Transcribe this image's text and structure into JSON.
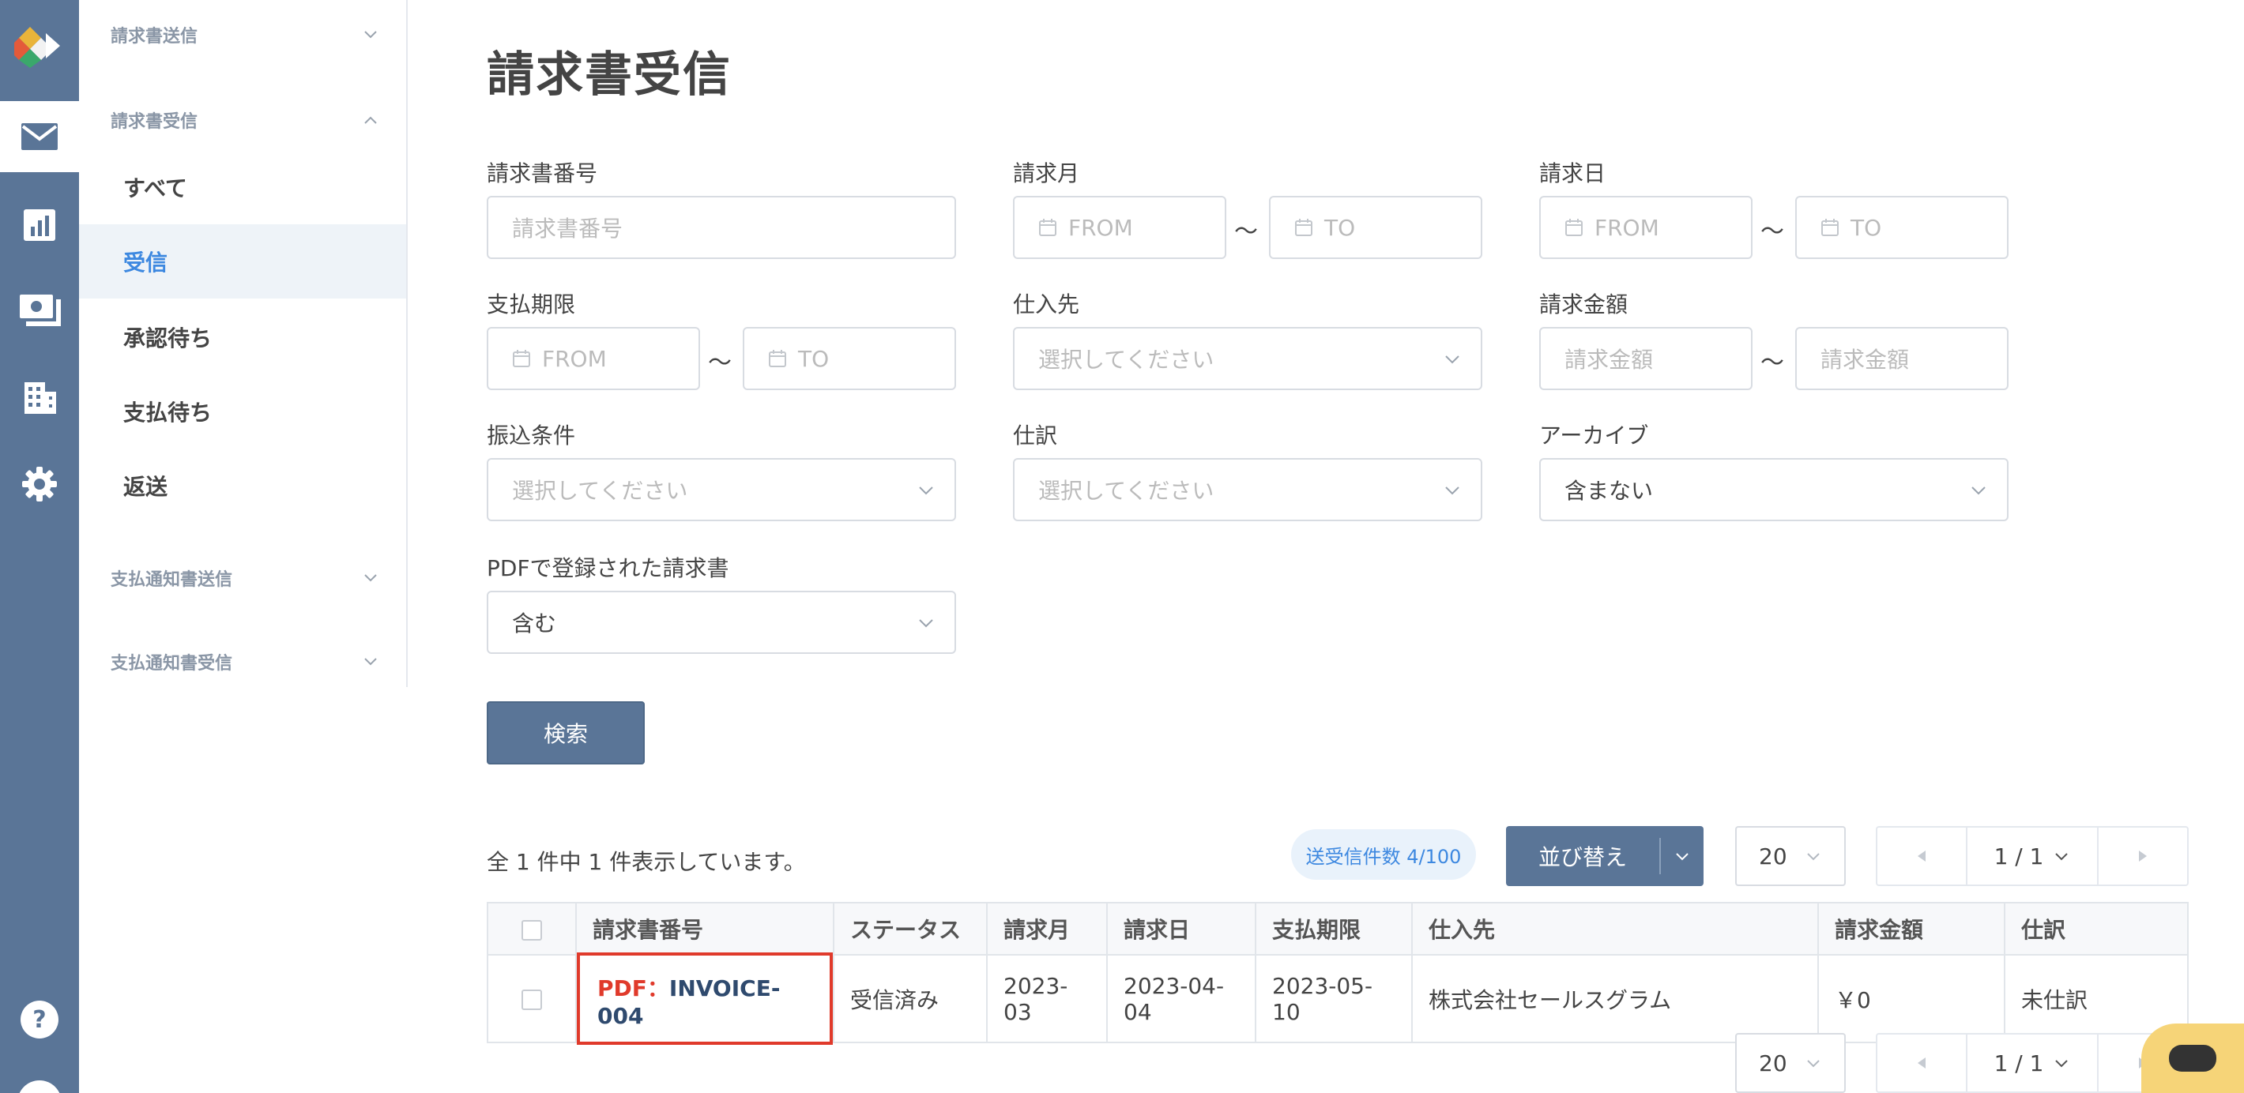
{
  "rail": {
    "items": [
      "logo-icon",
      "mail-icon",
      "chart-icon",
      "money-icon",
      "building-icon",
      "gear-icon",
      "help-icon"
    ]
  },
  "subnav": {
    "groups": [
      {
        "label": "請求書送信"
      },
      {
        "label": "請求書受信"
      },
      {
        "label": "支払通知書送信"
      },
      {
        "label": "支払通知書受信"
      }
    ],
    "items": [
      {
        "label": "すべて"
      },
      {
        "label": "受信"
      },
      {
        "label": "承認待ち"
      },
      {
        "label": "支払待ち"
      },
      {
        "label": "返送"
      }
    ]
  },
  "page": {
    "title": "請求書受信"
  },
  "filters": {
    "invoice_number": {
      "label": "請求書番号",
      "placeholder": "請求書番号"
    },
    "invoice_month": {
      "label": "請求月",
      "from": "FROM",
      "to": "TO"
    },
    "invoice_date": {
      "label": "請求日",
      "from": "FROM",
      "to": "TO"
    },
    "due_date": {
      "label": "支払期限",
      "from": "FROM",
      "to": "TO"
    },
    "supplier": {
      "label": "仕入先",
      "placeholder": "選択してください"
    },
    "amount": {
      "label": "請求金額",
      "from": "請求金額",
      "to": "請求金額"
    },
    "transfer": {
      "label": "振込条件",
      "placeholder": "選択してください"
    },
    "journal": {
      "label": "仕訳",
      "placeholder": "選択してください"
    },
    "archive": {
      "label": "アーカイブ",
      "value": "含まない"
    },
    "pdf": {
      "label": "PDFで登録された請求書",
      "value": "含む"
    },
    "tilde": "〜"
  },
  "actions": {
    "search": "検索",
    "sort": "並び替え"
  },
  "results": {
    "summary": "全 1 件中 1 件表示しています。",
    "quota": "送受信件数 4/100",
    "per_page": "20",
    "page": "1 / 1"
  },
  "table": {
    "headers": [
      "請求書番号",
      "ステータス",
      "請求月",
      "請求日",
      "支払期限",
      "仕入先",
      "請求金額",
      "仕訳"
    ],
    "rows": [
      {
        "pdf_prefix": "PDF：",
        "invoice_number": "INVOICE-004",
        "status": "受信済み",
        "month": "2023-03",
        "date": "2023-04-04",
        "due": "2023-05-10",
        "supplier": "株式会社セールスグラム",
        "amount": "￥0",
        "journal": "未仕訳"
      }
    ]
  },
  "colors": {
    "rail": "#5a7597",
    "accent": "#3d88e0",
    "highlight": "#e03a2b",
    "chat": "#f6d478"
  }
}
